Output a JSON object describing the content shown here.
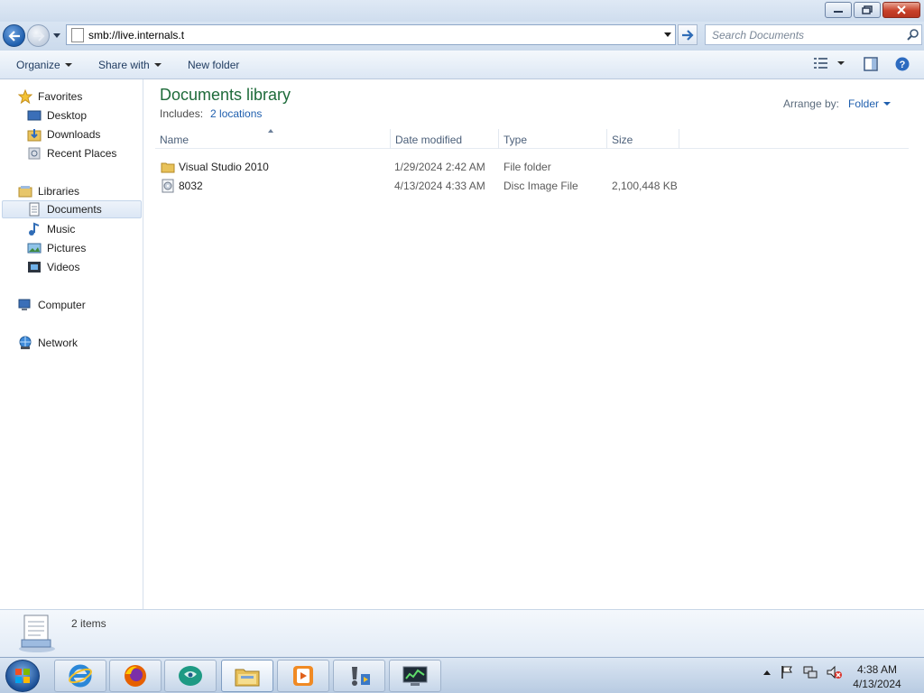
{
  "window": {
    "controls": [
      "minimize",
      "restore",
      "close"
    ]
  },
  "navigation": {
    "address": "smb://live.internals.t",
    "search_placeholder": "Search Documents"
  },
  "toolbar": {
    "organize_label": "Organize",
    "share_label": "Share with",
    "new_folder_label": "New folder"
  },
  "nav_pane": {
    "favorites": {
      "label": "Favorites",
      "items": [
        {
          "label": "Desktop",
          "icon": "desktop-icon"
        },
        {
          "label": "Downloads",
          "icon": "downloads-icon"
        },
        {
          "label": "Recent Places",
          "icon": "recent-places-icon"
        }
      ]
    },
    "libraries": {
      "label": "Libraries",
      "items": [
        {
          "label": "Documents",
          "icon": "documents-icon",
          "selected": true
        },
        {
          "label": "Music",
          "icon": "music-icon"
        },
        {
          "label": "Pictures",
          "icon": "pictures-icon"
        },
        {
          "label": "Videos",
          "icon": "videos-icon"
        }
      ]
    },
    "computer": {
      "label": "Computer"
    },
    "network": {
      "label": "Network"
    }
  },
  "library": {
    "title": "Documents library",
    "includes_label": "Includes:",
    "includes_link": "2 locations",
    "arrange_label": "Arrange by:",
    "arrange_value": "Folder"
  },
  "columns": {
    "name": "Name",
    "date": "Date modified",
    "type": "Type",
    "size": "Size"
  },
  "files": [
    {
      "name": "Visual Studio 2010",
      "date": "1/29/2024 2:42 AM",
      "type": "File folder",
      "size": "",
      "icon": "folder-icon"
    },
    {
      "name": "8032",
      "date": "4/13/2024 4:33 AM",
      "type": "Disc Image File",
      "size": "2,100,448 KB",
      "icon": "disc-image-icon"
    }
  ],
  "status": {
    "item_count": "2 items"
  },
  "taskbar": {
    "apps": [
      "internet-explorer-icon",
      "firefox-icon",
      "app-icon",
      "explorer-icon",
      "media-player-icon",
      "tool-icon",
      "monitor-icon"
    ],
    "time": "4:38 AM",
    "date": "4/13/2024"
  }
}
